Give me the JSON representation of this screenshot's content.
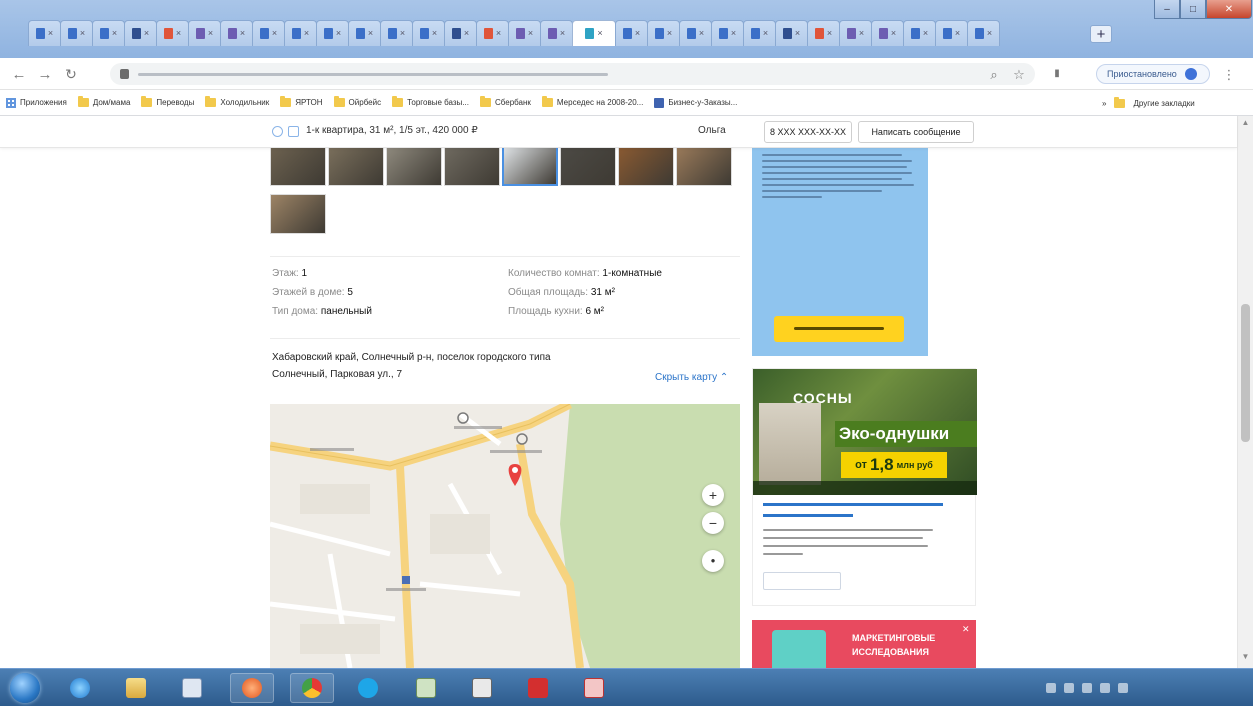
{
  "browser": {
    "tabs_count": 30,
    "active_tab_index": 17,
    "new_tab_label": "+",
    "bookmarks": [
      {
        "label": "Приложения",
        "icon": "apps-grid-icon"
      },
      {
        "label": "Дом/мама",
        "icon": "folder-icon"
      },
      {
        "label": "Переводы",
        "icon": "folder-icon"
      },
      {
        "label": "Холодильник",
        "icon": "folder-icon"
      },
      {
        "label": "ЯРТОН",
        "icon": "folder-icon"
      },
      {
        "label": "Ойрбейс",
        "icon": "folder-icon"
      },
      {
        "label": "Торговые базы...",
        "icon": "folder-icon"
      },
      {
        "label": "Сбербанк",
        "icon": "folder-icon"
      },
      {
        "label": "Мерседес на 2008-20...",
        "icon": "folder-icon"
      },
      {
        "label": "Бизнес-у-Заказы...",
        "icon": "bookmark-icon"
      }
    ],
    "other_bookmarks": "Другие закладки",
    "translate_button": "Приостановлено",
    "colors": {
      "titlebar": "#a9c5e8",
      "taskbar": "#2d5b8c",
      "accent_link": "#2b74c9"
    }
  },
  "listing": {
    "sticky_title": "1-к квартира, 31 м², 1/5 эт., 420 000 ₽",
    "seller_name": "Ольга",
    "phone_button": "8 XXX XXX-XX-XX",
    "message_button": "Написать сообщение",
    "thumbnails_count": 9,
    "params_left": [
      {
        "label": "Этаж:",
        "value": "1"
      },
      {
        "label": "Этажей в доме:",
        "value": "5"
      },
      {
        "label": "Тип дома:",
        "value": "панельный"
      }
    ],
    "params_right": [
      {
        "label": "Количество комнат:",
        "value": "1-комнатные"
      },
      {
        "label": "Общая площадь:",
        "value": "31 м²"
      },
      {
        "label": "Площадь кухни:",
        "value": "6 м²"
      }
    ],
    "address_line1": "Хабаровский край, Солнечный р-н, поселок городского типа",
    "address_line2": "Солнечный, Парковая ул., 7",
    "hide_map_link": "Скрыть карту ⌃",
    "map": {
      "zoom_in": "+",
      "zoom_out": "−",
      "locate": "●",
      "colors": {
        "background": "#efece6",
        "park": "#c9ddb0",
        "road_main": "#f6d37f",
        "pin": "#e8423f"
      }
    }
  },
  "ads": {
    "ad2": {
      "brand": "СОСНЫ",
      "headline": "Эко-однушки",
      "price_from": "от",
      "price_value": "1,8",
      "price_unit": "млн руб"
    },
    "ad3": {
      "line1": "МАРКЕТИНГОВЫЕ",
      "line2": "ИССЛЕДОВАНИЯ"
    }
  }
}
